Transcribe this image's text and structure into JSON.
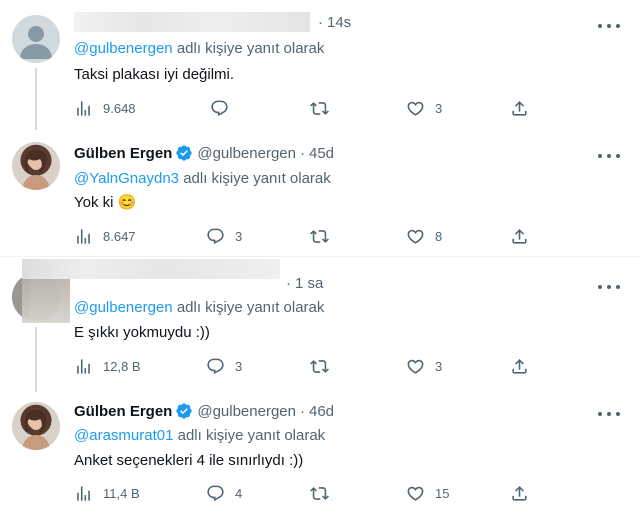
{
  "tweets": [
    {
      "time": "14s",
      "reply_label": "adlı kişiye yanıt olarak",
      "reply_to": "@gulbenergen",
      "text": "Taksi plakası iyi değilmi.",
      "views": "9.648",
      "replies": "",
      "retweets": "",
      "likes": "3"
    },
    {
      "name": "Gülben Ergen",
      "handle": "@gulbenergen",
      "time": "45d",
      "reply_label": "adlı kişiye yanıt olarak",
      "reply_to": "@YalnGnaydn3",
      "text": "Yok ki 😊",
      "views": "8.647",
      "replies": "3",
      "retweets": "",
      "likes": "8"
    },
    {
      "time": "1 sa",
      "reply_label": "adlı kişiye yanıt olarak",
      "reply_to": "@gulbenergen",
      "text": "E şıkkı yokmuydu :))",
      "views": "12,8 B",
      "replies": "3",
      "retweets": "",
      "likes": "3"
    },
    {
      "name": "Gülben Ergen",
      "handle": "@gulbenergen",
      "time": "46d",
      "reply_label": "adlı kişiye yanıt olarak",
      "reply_to": "@arasmurat01",
      "text": "Anket seçenekleri 4 ile sınırlıydı :))",
      "views": "11,4 B",
      "replies": "4",
      "retweets": "",
      "likes": "15"
    }
  ],
  "colors": {
    "link": "#1d9bf0",
    "muted": "#536471",
    "verified": "#1d9bf0"
  }
}
